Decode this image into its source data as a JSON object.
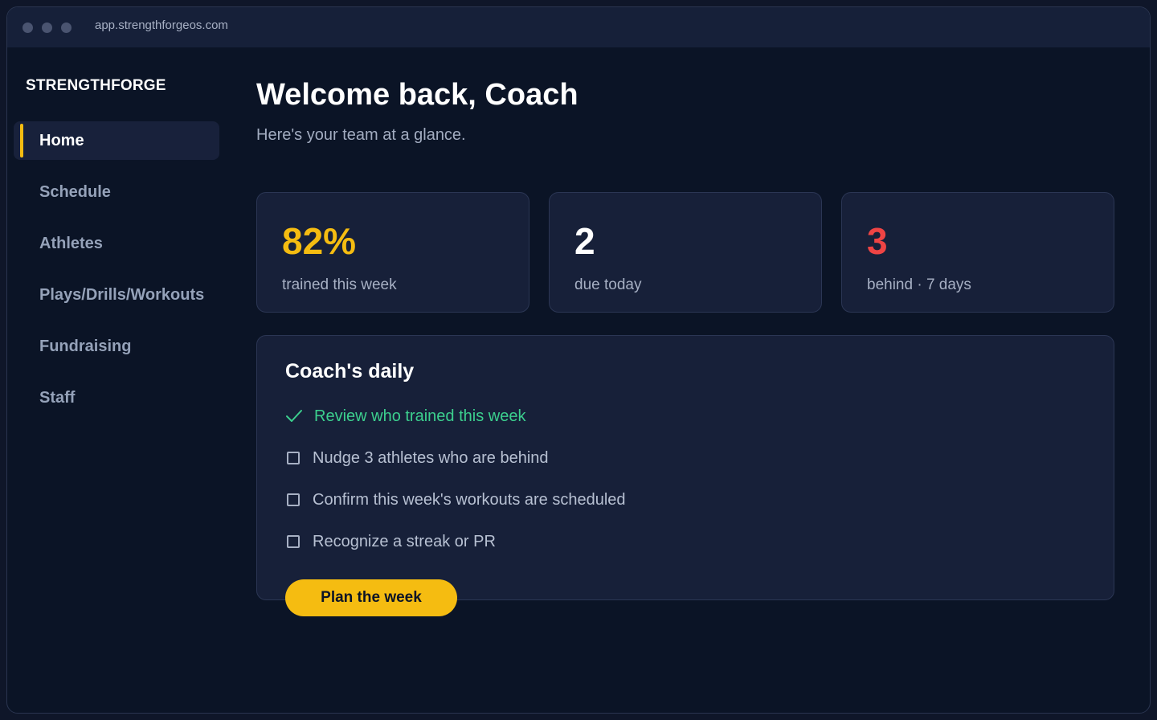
{
  "browser": {
    "url": "app.strengthforgeos.com"
  },
  "sidebar": {
    "brand": "STRENGTHFORGE",
    "items": [
      {
        "label": "Home",
        "active": true
      },
      {
        "label": "Schedule"
      },
      {
        "label": "Athletes"
      },
      {
        "label": "Plays/Drills/Workouts"
      },
      {
        "label": "Fundraising"
      },
      {
        "label": "Staff"
      }
    ]
  },
  "header": {
    "title": "Welcome back, Coach",
    "subtitle": "Here's your team at a glance."
  },
  "stats": [
    {
      "value": "82%",
      "label": "trained this week",
      "color": "#f5bc11"
    },
    {
      "value": "2",
      "label": "due today",
      "color": "#ffffff"
    },
    {
      "value": "3",
      "label": "behind · 7 days",
      "color": "#ef4444"
    }
  ],
  "daily": {
    "title": "Coach's daily",
    "tasks": [
      {
        "label": "Review who trained this week",
        "done": true
      },
      {
        "label": "Nudge 3 athletes who are behind",
        "done": false
      },
      {
        "label": "Confirm this week's workouts are scheduled",
        "done": false
      },
      {
        "label": "Recognize a streak or PR",
        "done": false
      }
    ]
  },
  "cta": {
    "label": "Plan the week"
  },
  "colors": {
    "accent": "#f5bc11",
    "success": "#3ccf8e",
    "danger": "#ef4444"
  }
}
